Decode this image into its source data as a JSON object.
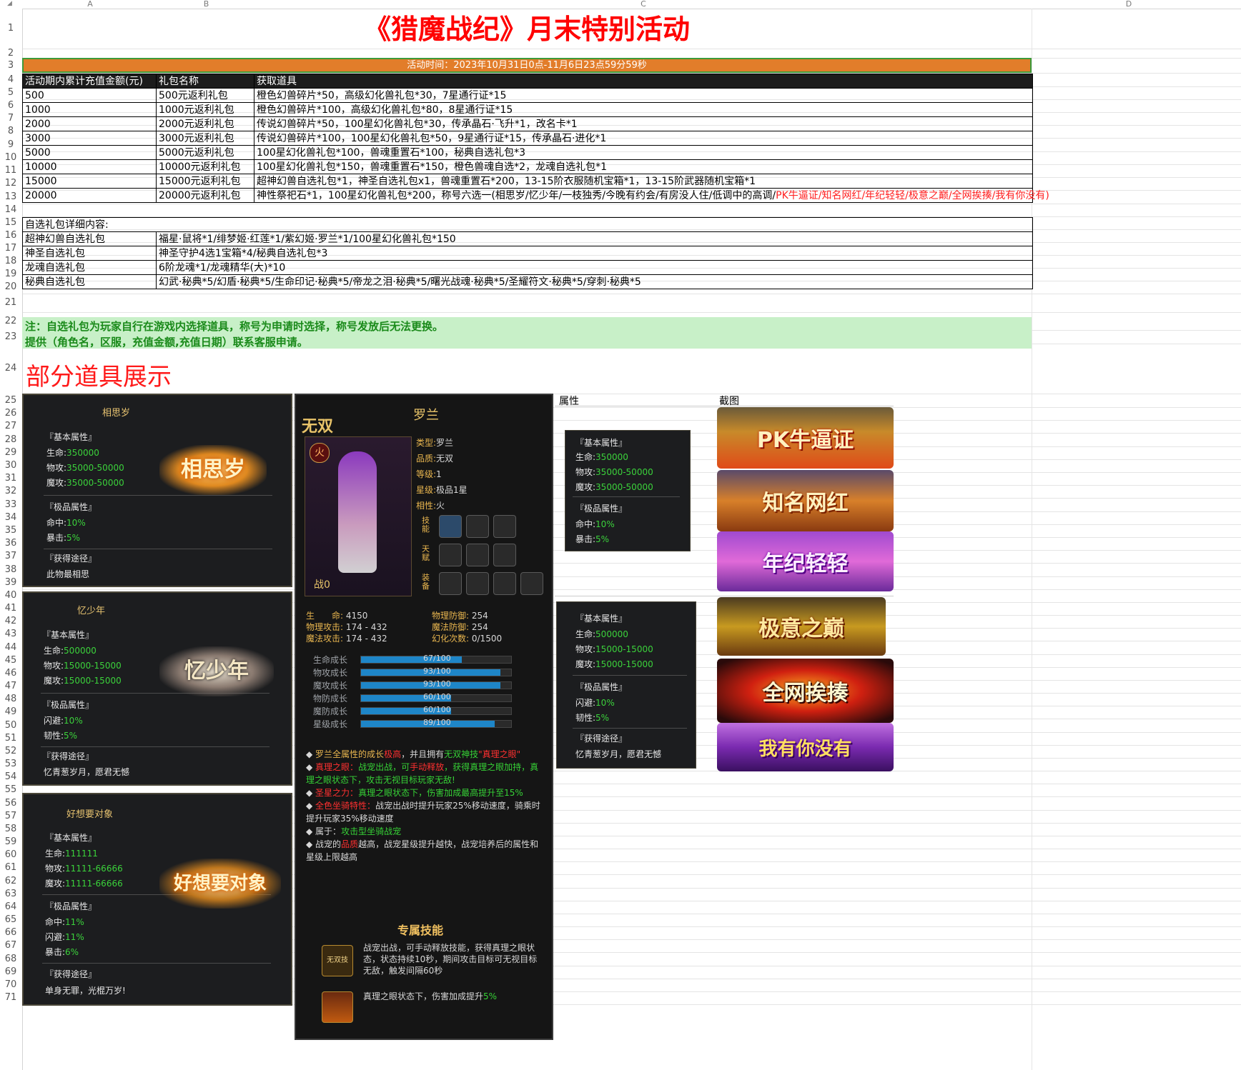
{
  "sheet": {
    "columns": [
      "A",
      "B",
      "C",
      "D"
    ],
    "rows": [
      "1",
      "2",
      "3",
      "4",
      "5",
      "6",
      "7",
      "8",
      "9",
      "10",
      "11",
      "12",
      "13",
      "14",
      "15",
      "16",
      "17",
      "18",
      "19",
      "20",
      "21",
      "22",
      "23",
      "24",
      "25",
      "26",
      "27",
      "28",
      "29",
      "30",
      "31",
      "32",
      "33",
      "34",
      "35",
      "36",
      "37",
      "38",
      "39",
      "40",
      "41",
      "42",
      "43",
      "44",
      "45",
      "46",
      "47",
      "48",
      "49",
      "50",
      "51",
      "52",
      "53",
      "54",
      "55",
      "56",
      "57",
      "58",
      "59",
      "60",
      "61",
      "62",
      "63",
      "64",
      "65",
      "66",
      "67",
      "68",
      "69",
      "70",
      "71"
    ]
  },
  "title": "《猎魔战纪》月末特别活动",
  "activity_time": "活动时间：2023年10月31日0点-11月6日23点59分59秒",
  "table": {
    "headers": [
      "活动期内累计充值金额(元)",
      "礼包名称",
      "获取道具"
    ],
    "rows": [
      {
        "amount": "500",
        "pack": "500元返利礼包",
        "items": "橙色幻兽碎片*50，高级幻化兽礼包*30，7星通行证*15"
      },
      {
        "amount": "1000",
        "pack": "1000元返利礼包",
        "items": "橙色幻兽碎片*100，高级幻化兽礼包*80，8星通行证*15"
      },
      {
        "amount": "2000",
        "pack": "2000元返利礼包",
        "items": "传说幻兽碎片*50，100星幻化兽礼包*30，传承晶石·飞升*1，改名卡*1"
      },
      {
        "amount": "3000",
        "pack": "3000元返利礼包",
        "items": "传说幻兽碎片*100，100星幻化兽礼包*50，9星通行证*15，传承晶石·进化*1"
      },
      {
        "amount": "5000",
        "pack": "5000元返利礼包",
        "items": "100星幻化兽礼包*100，兽魂重置石*100，秘典自选礼包*3"
      },
      {
        "amount": "10000",
        "pack": "10000元返利礼包",
        "items": "100星幻化兽礼包*150，兽魂重置石*150，橙色兽魂自选*2，龙魂自选礼包*1"
      },
      {
        "amount": "15000",
        "pack": "15000元返利礼包",
        "items": "超神幻兽自选礼包*1，神圣自选礼包x1，兽魂重置石*200，13-15阶衣服随机宝箱*1，13-15阶武器随机宝箱*1"
      },
      {
        "amount": "20000",
        "pack": "20000元返利礼包",
        "items": "神性祭祀石*1，100星幻化兽礼包*200，称号六选一(相思岁/忆少年/一枝独秀/今晚有约会/有房没人住/低调中的高调/",
        "items_red": "PK牛逼证/知名网红/年纪轻轻/极意之巅/全网挨揍/我有你没有",
        "items_tail": ")"
      }
    ]
  },
  "optional": {
    "heading": "自选礼包详细内容:",
    "rows": [
      {
        "name": "超神幻兽自选礼包",
        "content": "福星·鼠将*1/绯梦姬·红莲*1/紫幻姬·罗兰*1/100星幻化兽礼包*150"
      },
      {
        "name": "神圣自选礼包",
        "content": "神圣守护4选1宝箱*4/秘典自选礼包*3"
      },
      {
        "name": "龙魂自选礼包",
        "content": "6阶龙魂*1/龙魂精华(大)*10"
      },
      {
        "name": "秘典自选礼包",
        "content": "幻武·秘典*5/幻盾·秘典*5/生命印记·秘典*5/帝龙之泪·秘典*5/曙光战魂·秘典*5/圣耀符文·秘典*5/穿刺·秘典*5"
      }
    ]
  },
  "notes": [
    "注：自选礼包为玩家自行在游戏内选择道具，称号为申请时选择，称号发放后无法更换。",
    "提供（角色名，区服，充值金额,充值日期）联系客服申请。"
  ],
  "showcase_heading": "部分道具展示",
  "cards": [
    {
      "title": "相思岁",
      "basic": "『基本属性』",
      "hp_label": "生命:",
      "hp": "350000",
      "pa_label": "物攻:",
      "pa": "35000-50000",
      "ma_label": "魔攻:",
      "ma": "35000-50000",
      "extra": "『极品属性』",
      "s1_label": "命中:",
      "s1": "10%",
      "s2_label": "暴击:",
      "s2": "5%",
      "src": "『获得途径』",
      "desc": "此物最相思",
      "badge": "相思岁"
    },
    {
      "title": "忆少年",
      "basic": "『基本属性』",
      "hp_label": "生命:",
      "hp": "500000",
      "pa_label": "物攻:",
      "pa": "15000-15000",
      "ma_label": "魔攻:",
      "ma": "15000-15000",
      "extra": "『极品属性』",
      "s1_label": "闪避:",
      "s1": "10%",
      "s2_label": "韧性:",
      "s2": "5%",
      "src": "『获得途径』",
      "desc": "忆青葱岁月，愿君无憾",
      "badge": "忆少年"
    },
    {
      "title": "好想要对象",
      "basic": "『基本属性』",
      "hp_label": "生命:",
      "hp": "111111",
      "pa_label": "物攻:",
      "pa": "11111-66666",
      "ma_label": "魔攻:",
      "ma": "11111-66666",
      "extra": "『极品属性』",
      "s1_label": "命中:",
      "s1": "11%",
      "s2_label": "闪避:",
      "s2": "11%",
      "s3_label": "暴击:",
      "s3": "6%",
      "src": "『获得途径』",
      "desc": "单身无罪，光棍万岁!",
      "badge": "好想要对象"
    }
  ],
  "role": {
    "rank": "无双",
    "name": "罗兰",
    "element_badge": "火",
    "type_label": "类型:",
    "type": "罗兰",
    "quality_label": "品质:",
    "quality": "无双",
    "level_label": "等级:",
    "level": "1",
    "star_label": "星级:",
    "star": "极品1星",
    "attr_label": "相性:",
    "attr": "火",
    "skill_label": "技能",
    "talent_label": "天赋",
    "equip_label": "装备",
    "power_label": "战",
    "power": "0",
    "stats": [
      {
        "label": "生　　命:",
        "value": "4150"
      },
      {
        "label": "物理攻击:",
        "value": "174 - 432"
      },
      {
        "label": "魔法攻击:",
        "value": "174 - 432"
      },
      {
        "label": "物理防御:",
        "value": "254"
      },
      {
        "label": "魔法防御:",
        "value": "254"
      },
      {
        "label": "幻化次数:",
        "value": "0/1500"
      }
    ],
    "growth": [
      {
        "label": "生命成长",
        "text": "67/100",
        "ratio": 0.67
      },
      {
        "label": "物攻成长",
        "text": "93/100",
        "ratio": 0.93
      },
      {
        "label": "魔攻成长",
        "text": "93/100",
        "ratio": 0.93
      },
      {
        "label": "物防成长",
        "text": "60/100",
        "ratio": 0.6
      },
      {
        "label": "魔防成长",
        "text": "60/100",
        "ratio": 0.6
      },
      {
        "label": "星级成长",
        "text": "89/100",
        "ratio": 0.89
      }
    ],
    "desc": [
      {
        "a": "罗兰全属性的成长",
        "b": "极高",
        "c": "，并且拥有",
        "d": "无双神技",
        "e": "\"真理之眼\""
      },
      {
        "a": "真理之眼：",
        "b": "战宠出战，可",
        "c": "手动释放",
        "d": "，获得真理之眼加持，真理之眼状态下，攻击无视目标玩家无敌!",
        "e": ""
      },
      {
        "a": "圣星之力：",
        "b": "真理之眼状态下，伤害加成最高提升至15%",
        "c": "",
        "d": "",
        "e": ""
      },
      {
        "a": "全色坐骑特性：",
        "b": "战宠出战时提升玩家25%移动速度，骑乘时提升玩家35%移动速度",
        "c": "",
        "d": "",
        "e": ""
      },
      {
        "a": "属于：",
        "b": "攻击型坐骑战宠",
        "c": "",
        "d": "",
        "e": ""
      },
      {
        "a": "战宠的",
        "b": "品质",
        "c": "越高，战宠星级提升越快，战宠培养后的属性和星级上限越高",
        "d": "",
        "e": ""
      }
    ],
    "exclusive": "专属技能",
    "skill1_icon": "无双技",
    "skill1": "战宠出战，可手动释放技能，获得真理之眼状态，状态持续10秒，期间攻击目标可无视目标无敌，触发间隔60秒",
    "skill2a": "真理之眼状态下，伤害加成提升",
    "skill2b": "5%"
  },
  "right": {
    "attr_header": "属性",
    "shot_header": "截图",
    "card1": {
      "basic": "『基本属性』",
      "hp_label": "生命:",
      "hp": "350000",
      "pa_label": "物攻:",
      "pa": "35000-50000",
      "ma_label": "魔攻:",
      "ma": "35000-50000",
      "extra": "『极品属性』",
      "s1_label": "命中:",
      "s1": "10%",
      "s2_label": "暴击:",
      "s2": "5%"
    },
    "card2": {
      "basic": "『基本属性』",
      "hp_label": "生命:",
      "hp": "500000",
      "pa_label": "物攻:",
      "pa": "15000-15000",
      "ma_label": "魔攻:",
      "ma": "15000-15000",
      "extra": "『极品属性』",
      "s1_label": "闪避:",
      "s1": "10%",
      "s2_label": "韧性:",
      "s2": "5%",
      "src": "『获得途径』",
      "desc": "忆青葱岁月，愿君无憾"
    },
    "titles": [
      "PK牛逼证",
      "知名网红",
      "年纪轻轻",
      "极意之巅",
      "全网挨揍",
      "我有你没有"
    ]
  },
  "colors": {
    "title_red": "#ff0000",
    "bar_orange": "#e27d2a",
    "note_green_bg": "#c8f0c8",
    "note_text": "#1a8a1a"
  }
}
